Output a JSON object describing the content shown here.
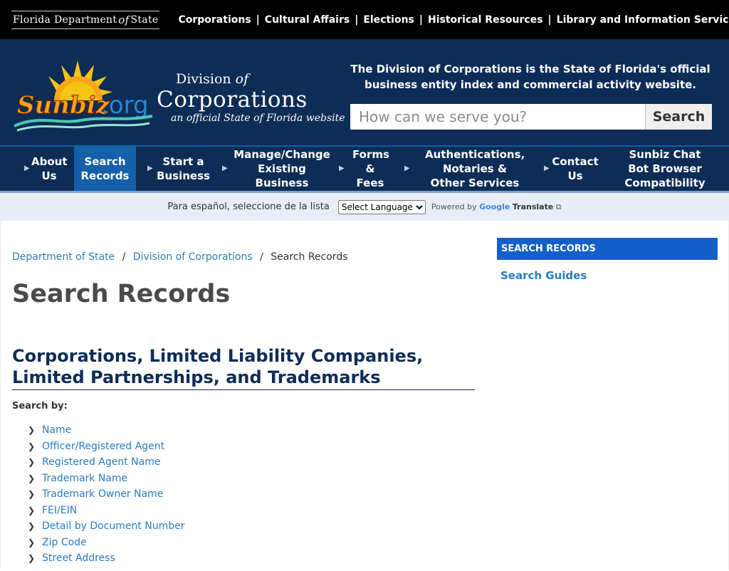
{
  "topbar": {
    "logo": {
      "part1": "Florida Department",
      "of": "of",
      "part2": "State"
    },
    "links": [
      "Corporations",
      "Cultural Affairs",
      "Elections",
      "Historical Resources",
      "Library and Information Services"
    ]
  },
  "header": {
    "logo_text": {
      "sun": "Sunbiz",
      "org": ".org"
    },
    "division_line1": "Division",
    "division_of": "of",
    "division_line2": "Corporations",
    "subtitle": "an official State of Florida website",
    "tagline": "The Division of Corporations is the State of Florida's official business entity index and commercial activity website.",
    "search_placeholder": "How can we serve you?",
    "search_button": "Search"
  },
  "nav": {
    "items": [
      {
        "label": "About Us"
      },
      {
        "label": "Search Records",
        "active": true
      },
      {
        "label": "Start a Business"
      },
      {
        "label": "Manage/Change Existing Business"
      },
      {
        "label": "Forms & Fees"
      },
      {
        "label": "Authentications, Notaries & Other Services"
      },
      {
        "label": "Contact Us"
      },
      {
        "label": "Sunbiz Chat Bot Browser Compatibility"
      }
    ]
  },
  "translate": {
    "prompt": "Para español, seleccione de la lista",
    "select_label": "Select Language",
    "powered_by": "Powered by",
    "google": "Google",
    "translate": "Translate"
  },
  "breadcrumb": {
    "items": [
      "Department of State",
      "Division of Corporations",
      "Search Records"
    ]
  },
  "main": {
    "title": "Search Records",
    "section_title": "Corporations, Limited Liability Companies, Limited Partnerships, and Trademarks",
    "search_by_label": "Search by:",
    "search_links": [
      "Name",
      "Officer/Registered Agent",
      "Registered Agent Name",
      "Trademark Name",
      "Trademark Owner Name",
      "FEI/EIN",
      "Detail by Document Number",
      "Zip Code",
      "Street Address"
    ]
  },
  "sidebar": {
    "heading": "SEARCH RECORDS",
    "link": "Search Guides"
  },
  "colors": {
    "navy": "#0d2c56",
    "active_blue": "#1560a8",
    "link_blue": "#2a7bc0"
  }
}
